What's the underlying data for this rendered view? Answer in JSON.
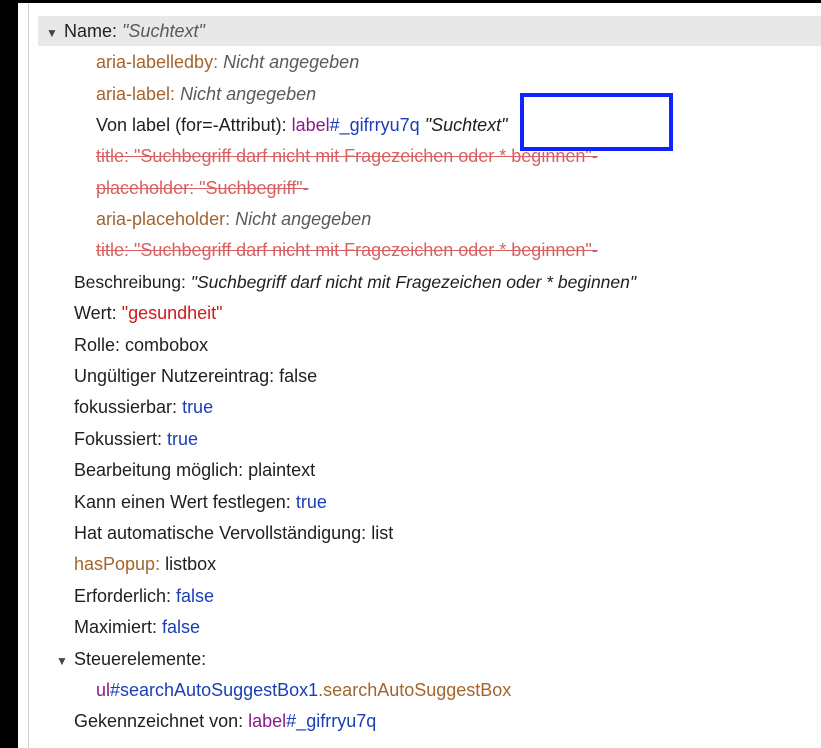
{
  "properties": {
    "name": {
      "label": "Name:",
      "value": "\"Suchtext\""
    },
    "aria_labelledby": {
      "key": "aria-labelledby:",
      "value": "Nicht angegeben"
    },
    "aria_label": {
      "key": "aria-label:",
      "value": "Nicht angegeben"
    },
    "von_label": {
      "key": "Von label (for=-Attribut):",
      "ref_prefix": "label",
      "ref_id": "#_gifrryu7q",
      "value": "\"Suchtext\""
    },
    "title_1": {
      "key": "title:",
      "value": "\"Suchbegriff darf nicht mit Fragezeichen oder * beginnen\"",
      "suffix": "-"
    },
    "placeholder": {
      "key": "placeholder:",
      "value": "\"Suchbegriff\"",
      "suffix": "-"
    },
    "aria_placeholder": {
      "key": "aria-placeholder:",
      "value": "Nicht angegeben"
    },
    "title_2": {
      "key": "title:",
      "value": "\"Suchbegriff darf nicht mit Fragezeichen oder * beginnen\"",
      "suffix": "-"
    },
    "beschreibung": {
      "key": "Beschreibung:",
      "value": "\"Suchbegriff darf nicht mit Fragezeichen oder * beginnen\""
    },
    "wert": {
      "key": "Wert:",
      "value": "\"gesundheit\""
    },
    "rolle": {
      "key": "Rolle:",
      "value": "combobox"
    },
    "ungueltig": {
      "key": "Ungültiger Nutzereintrag:",
      "value": "false"
    },
    "fokussierbar": {
      "key": "fokussierbar:",
      "value": "true"
    },
    "fokussiert": {
      "key": "Fokussiert:",
      "value": "true"
    },
    "bearbeitung": {
      "key": "Bearbeitung möglich:",
      "value": "plaintext"
    },
    "kann_wert": {
      "key": "Kann einen Wert festlegen:",
      "value": "true"
    },
    "autovervoll": {
      "key": "Hat automatische Vervollständigung:",
      "value": "list"
    },
    "haspopup": {
      "key": "hasPopup:",
      "value": "listbox"
    },
    "erforderlich": {
      "key": "Erforderlich:",
      "value": "false"
    },
    "maximiert": {
      "key": "Maximiert:",
      "value": "false"
    },
    "steuerelemente": {
      "label": "Steuerelemente:",
      "ref_prefix": "ul",
      "ref_id": "#searchAutoSuggestBox1",
      "ref_class": ".searchAutoSuggestBox"
    },
    "gekennzeichnet": {
      "key": "Gekennzeichnet von:",
      "ref_prefix": "label",
      "ref_id": "#_gifrryu7q"
    }
  },
  "colors": {
    "highlight_box": "#1024ff",
    "key_brown": "#a3652c",
    "value_red": "#d11a1a",
    "value_blue": "#1a3fb5",
    "value_purple": "#8a1a8a"
  },
  "icons": {
    "expand": "triangle-down-icon"
  }
}
